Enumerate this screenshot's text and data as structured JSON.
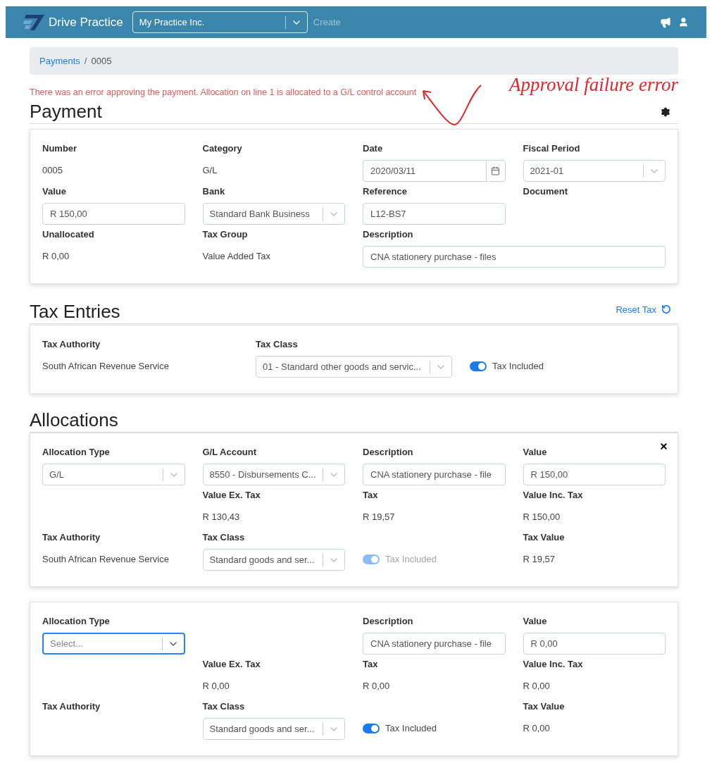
{
  "header": {
    "brand": "Drive Practice",
    "company": {
      "value": "My Practice Inc."
    },
    "create": "Create"
  },
  "breadcrumb": {
    "link": "Payments",
    "separator": "/",
    "current": "0005"
  },
  "error": "There was an error approving the payment. Allocation on line 1 is allocated to a G/L control account",
  "annotation": "Approval failure error",
  "payment": {
    "title": "Payment",
    "fields": [
      {
        "label": "Number",
        "kind": "text",
        "value": "0005"
      },
      {
        "label": "Category",
        "kind": "text",
        "value": "G/L"
      },
      {
        "label": "Date",
        "kind": "date",
        "value": "2020/03/11"
      },
      {
        "label": "Fiscal Period",
        "kind": "select",
        "value": "2021-01"
      },
      {
        "label": "Value",
        "kind": "input",
        "value": "R 150,00"
      },
      {
        "label": "Bank",
        "kind": "select",
        "value": "Standard Bank Business"
      },
      {
        "label": "Reference",
        "kind": "input",
        "value": "L12-BS7"
      },
      {
        "label": "Document"
      },
      {
        "label": "Unallocated",
        "kind": "text",
        "value": "R 0,00"
      },
      {
        "label": "Tax Group",
        "kind": "text",
        "value": "Value Added Tax"
      },
      {
        "label": "Description",
        "kind": "input",
        "value": "CNA stationery purchase - files"
      }
    ]
  },
  "tax_entries": {
    "title": "Tax Entries",
    "reset": "Reset Tax",
    "fields": [
      {
        "label": "Tax Authority",
        "kind": "text",
        "value": "South African Revenue Service"
      },
      {
        "label": "Tax Class",
        "kind": "select",
        "value": "01 - Standard other goods and servic..."
      },
      {
        "kind": "toggle",
        "label": "Tax Included",
        "on": true,
        "disabled": false
      }
    ]
  },
  "allocations": {
    "title": "Allocations",
    "items": [
      {
        "removable": true,
        "fields": [
          {
            "label": "Allocation Type",
            "kind": "select",
            "value": "G/L"
          },
          {
            "label": "G/L Account",
            "kind": "select",
            "value": "8550 - Disbursements C..."
          },
          {
            "label": "Description",
            "kind": "input",
            "value": "CNA stationery purchase - file"
          },
          {
            "label": "Value",
            "kind": "input",
            "value": "R 150,00"
          },
          {
            "kind": "blank"
          },
          {
            "label": "Value Ex. Tax",
            "kind": "text",
            "value": "R 130,43"
          },
          {
            "label": "Tax",
            "kind": "text",
            "value": "R 19,57"
          },
          {
            "label": "Value Inc. Tax",
            "kind": "text",
            "value": "R 150,00"
          },
          {
            "label": "Tax Authority",
            "kind": "text",
            "value": "South African Revenue Service"
          },
          {
            "label": "Tax Class",
            "kind": "select",
            "value": "Standard goods and ser..."
          },
          {
            "kind": "toggle",
            "label": "Tax Included",
            "on": true,
            "disabled": true
          },
          {
            "label": "Tax Value",
            "kind": "text",
            "value": "R 19,57"
          }
        ]
      },
      {
        "removable": false,
        "fields": [
          {
            "label": "Allocation Type",
            "kind": "select",
            "placeholder": "Select...",
            "focused": true
          },
          {
            "kind": "blank"
          },
          {
            "label": "Description",
            "kind": "input",
            "value": "CNA stationery purchase - file"
          },
          {
            "label": "Value",
            "kind": "input",
            "value": "R 0,00"
          },
          {
            "kind": "blank"
          },
          {
            "label": "Value Ex. Tax",
            "kind": "text",
            "value": "R 0,00"
          },
          {
            "label": "Tax",
            "kind": "text",
            "value": "R 0,00"
          },
          {
            "label": "Value Inc. Tax",
            "kind": "text",
            "value": "R 0,00"
          },
          {
            "label": "Tax Authority"
          },
          {
            "label": "Tax Class",
            "kind": "select",
            "value": "Standard goods and ser..."
          },
          {
            "kind": "toggle",
            "label": "Tax Included",
            "on": true,
            "disabled": false
          },
          {
            "label": "Tax Value",
            "kind": "text",
            "value": "R 0,00"
          }
        ]
      }
    ]
  }
}
